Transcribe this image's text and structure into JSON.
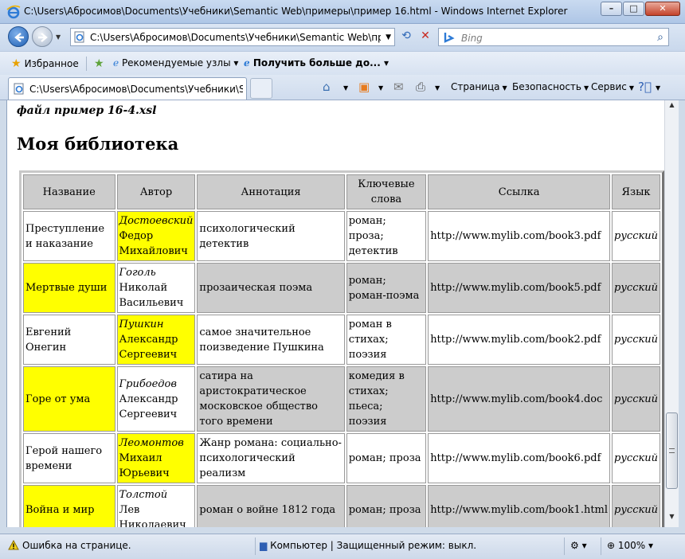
{
  "window": {
    "title": "C:\\Users\\Абросимов\\Documents\\Учебники\\Semantic Web\\примеры\\пример 16.html - Windows Internet Explorer"
  },
  "address_bar": {
    "url": "C:\\Users\\Абросимов\\Documents\\Учебники\\Semantic Web\\приме",
    "search_placeholder": "Bing"
  },
  "favorites_bar": {
    "favorites_label": "Избранное",
    "links": [
      "Рекомендуемые узлы",
      "Получить больше до..."
    ]
  },
  "tab": {
    "label": "C:\\Users\\Абросимов\\Documents\\Учебники\\Sem..."
  },
  "command_bar": {
    "page": "Страница",
    "safety": "Безопасность",
    "tools": "Сервис"
  },
  "page": {
    "file_note": "файл пример 16-4.xsl",
    "heading": "Моя библиотека",
    "table": {
      "headers": [
        "Название",
        "Автор",
        "Аннотация",
        "Ключевые слова",
        "Ссылка",
        "Язык"
      ],
      "rows": [
        {
          "title": "Преступление и наказание",
          "author_last": "Достоевский",
          "author_first": "Федор Михайлович",
          "annotation": "психологический детектив",
          "keywords": "роман; проза; детектив",
          "link": "http://www.mylib.com/book3.pdf",
          "language": "русский"
        },
        {
          "title": "Мертвые души",
          "author_last": "Гоголь",
          "author_first": "Николай Васильевич",
          "annotation": "прозаическая поэма",
          "keywords": "роман; роман-поэма",
          "link": "http://www.mylib.com/book5.pdf",
          "language": "русский"
        },
        {
          "title": "Евгений Онегин",
          "author_last": "Пушкин",
          "author_first": "Александр Сергеевич",
          "annotation": "самое значительное поизведение Пушкина",
          "keywords": "роман в стихах; поэзия",
          "link": "http://www.mylib.com/book2.pdf",
          "language": "русский"
        },
        {
          "title": "Горе от ума",
          "author_last": "Грибоедов",
          "author_first": "Александр Сергеевич",
          "annotation": "сатира на аристократическое московское общество того времени",
          "keywords": "комедия в стихах; пьеса; поэзия",
          "link": "http://www.mylib.com/book4.doc",
          "language": "русский"
        },
        {
          "title": "Герой нашего времени",
          "author_last": "Леомонтов",
          "author_first": "Михаил Юрьевич",
          "annotation": "Жанр романа: социально-психологический реализм",
          "keywords": "роман; проза",
          "link": "http://www.mylib.com/book6.pdf",
          "language": "русский"
        },
        {
          "title": "Война и мир",
          "author_last": "Толстой",
          "author_first": "Лев Николаевич",
          "annotation": "роман о войне 1812 года",
          "keywords": "роман; проза",
          "link": "http://www.mylib.com/book1.html",
          "language": "русский"
        }
      ]
    }
  },
  "status_bar": {
    "error": "Ошибка на странице.",
    "zone": "Компьютер | Защищенный режим: выкл.",
    "zoom": "100%"
  },
  "colors": {
    "highlight_yellow": "#ffff00",
    "row_gray": "#cccccc"
  }
}
